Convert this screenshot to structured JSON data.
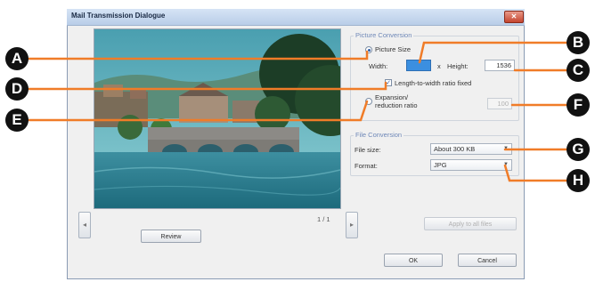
{
  "window": {
    "title": "Mail Transmission Dialogue",
    "close_glyph": "✕"
  },
  "viewer": {
    "page_indicator": "1 / 1",
    "prev_glyph": "◂",
    "next_glyph": "▸",
    "preview_label": "Review"
  },
  "picture_conversion": {
    "group_label": "Picture Conversion",
    "picture_size_label": "Picture Size",
    "picture_size_selected": true,
    "width_label": "Width:",
    "width_value": "",
    "times": "x",
    "height_label": "Height:",
    "height_value": "1536",
    "ratio_fixed_label": "Length-to-width ratio fixed",
    "ratio_fixed_checked": true,
    "expansion_label_line1": "Expansion/",
    "expansion_label_line2": "reduction ratio",
    "expansion_selected": false,
    "expansion_value": "100"
  },
  "file_conversion": {
    "group_label": "File Conversion",
    "file_size_label": "File size:",
    "file_size_value": "About 300 KB",
    "format_label": "Format:",
    "format_value": "JPG"
  },
  "apply_button_label": "Apply to all files",
  "ok_label": "OK",
  "cancel_label": "Cancel",
  "callouts": {
    "a": "A",
    "b": "B",
    "c": "C",
    "d": "D",
    "e": "E",
    "f": "F",
    "g": "G",
    "h": "H"
  },
  "colors": {
    "callout_line": "#f07c28",
    "callout_badge": "#111111",
    "width_highlight": "#3b8fe0"
  }
}
